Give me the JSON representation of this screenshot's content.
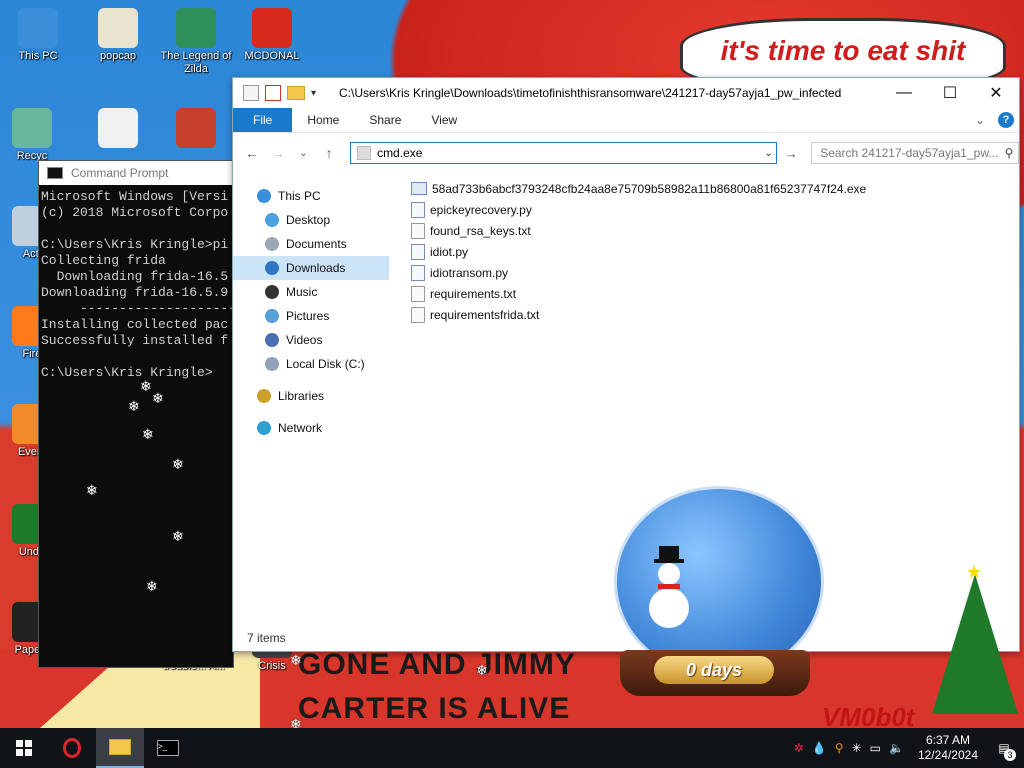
{
  "wallpaper": {
    "banner_text": "it's time to eat shit",
    "bottom_line_1": "GONE AND JIMMY",
    "bottom_line_2": "CARTER IS ALIVE",
    "signature": "VM0b0t",
    "snow_globe_text": "0 days",
    "colors": {
      "red": "#d8362a",
      "sky": "#3c8fe0",
      "banner_text": "#d11c1c"
    }
  },
  "desktop_icons": [
    {
      "label": "This PC",
      "icon": "computer-icon",
      "color": "#3a8fd8"
    },
    {
      "label": "popcap",
      "icon": "popcap-icon",
      "color": "#e9e4d0"
    },
    {
      "label": "The Legend of Zilda",
      "icon": "zelda-icon",
      "color": "#2f8f5a"
    },
    {
      "label": "MCDONAL",
      "icon": "mcdonalds-icon",
      "color": "#d72a1c"
    },
    {
      "label": "Recyc",
      "icon": "recycle-bin-icon",
      "color": "#6ab7a0"
    },
    {
      "label": "",
      "icon": "chicken-icon",
      "color": "#f0f0f0"
    },
    {
      "label": "",
      "icon": "angry-birds-seasons-icon",
      "color": "#c6402c"
    },
    {
      "label": "Acti",
      "icon": "activate-icon",
      "color": "#c0d0e0"
    },
    {
      "label": "Fire",
      "icon": "firefox-icon",
      "color": "#ff7a1a"
    },
    {
      "label": "Every",
      "icon": "everything-icon",
      "color": "#f2892a"
    },
    {
      "label": "Unde",
      "icon": "undertale-icon",
      "color": "#1f7a2a"
    },
    {
      "label": "Papers",
      "icon": "papers-icon",
      "color": "#222222"
    },
    {
      "label": "trouble... A...",
      "icon": "trouble-icon",
      "color": "#444444"
    },
    {
      "label": "Crisis",
      "icon": "crisis-icon",
      "color": "#444444"
    }
  ],
  "cmd": {
    "title": "Command Prompt",
    "lines": [
      "Microsoft Windows [Versi",
      "(c) 2018 Microsoft Corpo",
      "",
      "C:\\Users\\Kris Kringle>pi",
      "Collecting frida",
      "  Downloading frida-16.5",
      "Downloading frida-16.5.9",
      "     ----------------------",
      "Installing collected pac",
      "Successfully installed f",
      "",
      "C:\\Users\\Kris Kringle>"
    ]
  },
  "explorer": {
    "title_path": "C:\\Users\\Kris Kringle\\Downloads\\timetofinishthisransomware\\241217-day57ayja1_pw_infected",
    "ribbon_tabs": [
      "File",
      "Home",
      "Share",
      "View"
    ],
    "address_value": "cmd.exe",
    "search_placeholder": "Search 241217-day57ayja1_pw...",
    "nav_items": [
      {
        "label": "This PC",
        "icon": "this-pc-icon",
        "indent": false,
        "selected": false
      },
      {
        "label": "Desktop",
        "icon": "desktop-icon",
        "indent": true,
        "selected": false
      },
      {
        "label": "Documents",
        "icon": "documents-icon",
        "indent": true,
        "selected": false
      },
      {
        "label": "Downloads",
        "icon": "downloads-icon",
        "indent": true,
        "selected": true
      },
      {
        "label": "Music",
        "icon": "music-icon",
        "indent": true,
        "selected": false
      },
      {
        "label": "Pictures",
        "icon": "pictures-icon",
        "indent": true,
        "selected": false
      },
      {
        "label": "Videos",
        "icon": "videos-icon",
        "indent": true,
        "selected": false
      },
      {
        "label": "Local Disk (C:)",
        "icon": "local-disk-icon",
        "indent": true,
        "selected": false
      },
      {
        "label": "Libraries",
        "icon": "libraries-icon",
        "indent": false,
        "selected": false
      },
      {
        "label": "Network",
        "icon": "network-icon",
        "indent": false,
        "selected": false
      }
    ],
    "files": [
      {
        "name": "58ad733b6abcf3793248cfb24aa8e75709b58982a11b86800a81f65237747f24.exe",
        "type": "exe"
      },
      {
        "name": "epickeyrecovery.py",
        "type": "py"
      },
      {
        "name": "found_rsa_keys.txt",
        "type": "txt"
      },
      {
        "name": "idiot.py",
        "type": "py"
      },
      {
        "name": "idiotransom.py",
        "type": "py"
      },
      {
        "name": "requirements.txt",
        "type": "txt"
      },
      {
        "name": "requirementsfrida.txt",
        "type": "txt"
      }
    ],
    "status": "7 items"
  },
  "taskbar": {
    "time": "6:37 AM",
    "date": "12/24/2024",
    "notification_count": "3"
  }
}
